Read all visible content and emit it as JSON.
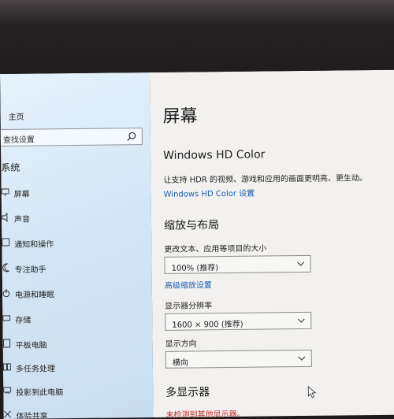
{
  "sidebar": {
    "home_label": "主页",
    "search_placeholder": "查找设置",
    "section_title": "系统",
    "items": [
      {
        "label": "屏幕",
        "icon": "monitor-icon"
      },
      {
        "label": "声音",
        "icon": "speaker-icon"
      },
      {
        "label": "通知和操作",
        "icon": "notification-icon"
      },
      {
        "label": "专注助手",
        "icon": "moon-icon"
      },
      {
        "label": "电源和睡眠",
        "icon": "power-icon"
      },
      {
        "label": "存储",
        "icon": "storage-icon"
      },
      {
        "label": "平板电脑",
        "icon": "tablet-icon"
      },
      {
        "label": "多任务处理",
        "icon": "multitask-icon"
      },
      {
        "label": "投影到此电脑",
        "icon": "project-icon"
      },
      {
        "label": "体验共享",
        "icon": "share-icon"
      }
    ]
  },
  "main": {
    "page_title": "屏幕",
    "hdr_heading": "Windows HD Color",
    "hdr_description": "让支持 HDR 的视频、游戏和应用的画面更明亮、更生动。",
    "hdr_link": "Windows HD Color 设置",
    "scale_heading": "缩放与布局",
    "scale_label": "更改文本、应用等项目的大小",
    "scale_value": "100% (推荐)",
    "advanced_scale_link": "高级缩放设置",
    "resolution_label": "显示器分辨率",
    "resolution_value": "1600 × 900 (推荐)",
    "orientation_label": "显示方向",
    "orientation_value": "横向",
    "multi_display_heading": "多显示器",
    "no_display_message": "未检测到其他显示器。"
  }
}
